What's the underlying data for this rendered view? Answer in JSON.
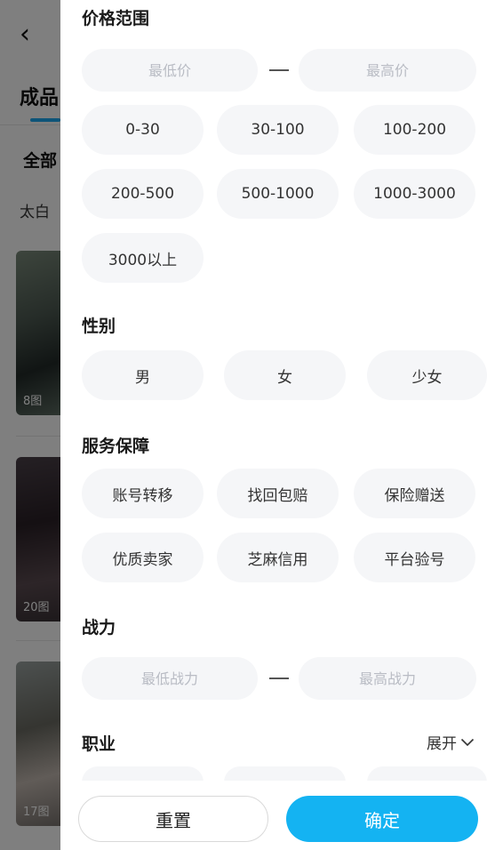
{
  "background": {
    "back_icon": "chevron-left-icon",
    "tab_label": "成品",
    "filter_label": "全部",
    "chip_label": "太白",
    "cards": [
      {
        "count": "8图"
      },
      {
        "count": "20图"
      },
      {
        "count": "17图"
      }
    ]
  },
  "filter": {
    "price": {
      "title": "价格范围",
      "min_placeholder": "最低价",
      "max_placeholder": "最高价",
      "options": [
        "0-30",
        "30-100",
        "100-200",
        "200-500",
        "500-1000",
        "1000-3000",
        "3000以上"
      ]
    },
    "gender": {
      "title": "性别",
      "options": [
        "男",
        "女",
        "少女"
      ]
    },
    "service": {
      "title": "服务保障",
      "options": [
        "账号转移",
        "找回包赔",
        "保险赠送",
        "优质卖家",
        "芝麻信用",
        "平台验号"
      ]
    },
    "power": {
      "title": "战力",
      "min_placeholder": "最低战力",
      "max_placeholder": "最高战力"
    },
    "job": {
      "title": "职业",
      "expand_label": "展开",
      "expand_icon": "chevron-down-icon"
    }
  },
  "footer": {
    "reset_label": "重置",
    "confirm_label": "确定"
  },
  "colors": {
    "accent": "#14b3f2",
    "chip_bg": "#f5f6f8",
    "overlay": "rgba(0,0,0,0.5)"
  }
}
